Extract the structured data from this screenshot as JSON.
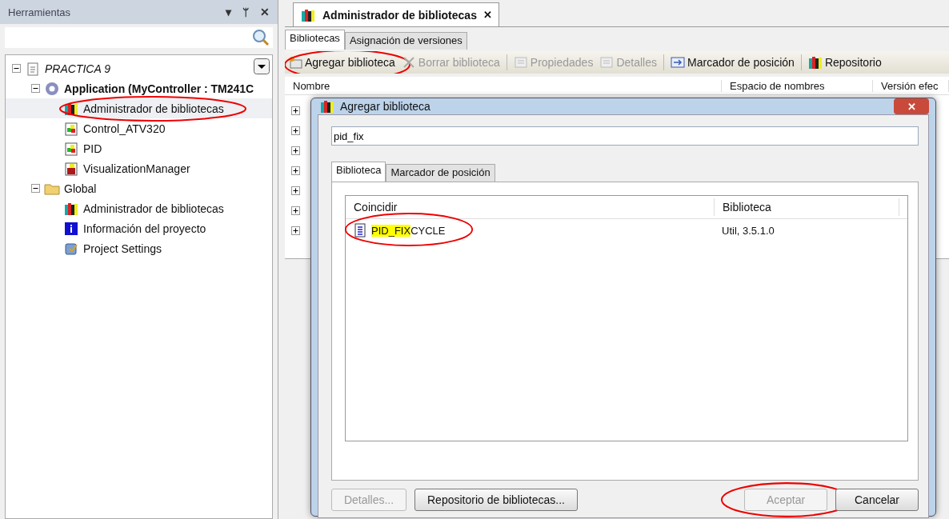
{
  "tools_panel": {
    "title": "Herramientas",
    "buttons": [
      "▾",
      "ᛘ",
      "✕"
    ]
  },
  "tree": [
    {
      "label": "PRACTICA 9",
      "kind": "project",
      "expanded": true,
      "children": [
        {
          "label": "Application (MyController : TM241C",
          "kind": "application",
          "expanded": true,
          "children": [
            {
              "label": "Administrador de bibliotecas",
              "kind": "library",
              "selected": true,
              "circled": true
            },
            {
              "label": "Control_ATV320",
              "kind": "pou",
              "selected": false,
              "circled": false
            },
            {
              "label": "PID",
              "kind": "pou",
              "selected": false,
              "circled": false
            },
            {
              "label": "VisualizationManager",
              "kind": "visualization",
              "selected": false,
              "circled": false
            }
          ]
        },
        {
          "label": "Global",
          "kind": "folder",
          "expanded": true,
          "children": [
            {
              "label": "Administrador de bibliotecas",
              "kind": "library",
              "selected": false,
              "circled": false
            },
            {
              "label": "Información del proyecto",
              "kind": "info",
              "selected": false,
              "circled": false
            },
            {
              "label": "Project Settings",
              "kind": "settings",
              "selected": false,
              "circled": false
            }
          ]
        }
      ]
    }
  ],
  "editor": {
    "tab": {
      "title": "Administrador de bibliotecas",
      "close": "✕"
    },
    "subtabs": [
      {
        "label": "Bibliotecas",
        "selected": true
      },
      {
        "label": "Asignación de versiones",
        "selected": false
      }
    ],
    "toolbar": [
      {
        "label": "Agregar biblioteca",
        "kind": "add",
        "disabled": false,
        "circled": true
      },
      {
        "label": "Borrar biblioteca",
        "kind": "delete",
        "disabled": true,
        "circled": false
      },
      {
        "label": "Propiedades",
        "kind": "properties",
        "disabled": true,
        "circled": false
      },
      {
        "label": "Detalles",
        "kind": "details",
        "disabled": true,
        "circled": false
      },
      {
        "label": "Marcador de posición",
        "kind": "placeholder",
        "disabled": false,
        "circled": false
      },
      {
        "label": "Repositorio",
        "kind": "repository",
        "disabled": false,
        "circled": false
      }
    ],
    "columns": [
      "Nombre",
      "Espacio de nombres",
      "Versión efec"
    ]
  },
  "dialog": {
    "title": "Agregar biblioteca",
    "close": "✕",
    "search_value": "pid_fix",
    "tabs": [
      {
        "label": "Biblioteca",
        "selected": true
      },
      {
        "label": "Marcador de posición",
        "selected": false
      }
    ],
    "columns": [
      "Coincidir",
      "Biblioteca"
    ],
    "results": [
      {
        "matched": "PID_FIX",
        "rest": "CYCLE",
        "library": "Util, 3.5.1.0",
        "circled": true
      }
    ],
    "buttons": [
      {
        "label": "Detalles...",
        "disabled": true,
        "circled": false
      },
      {
        "label": "Repositorio de bibliotecas...",
        "disabled": false,
        "circled": false
      },
      {
        "label": "Aceptar",
        "disabled": true,
        "circled": true
      },
      {
        "label": "Cancelar",
        "disabled": false,
        "circled": false
      }
    ]
  }
}
